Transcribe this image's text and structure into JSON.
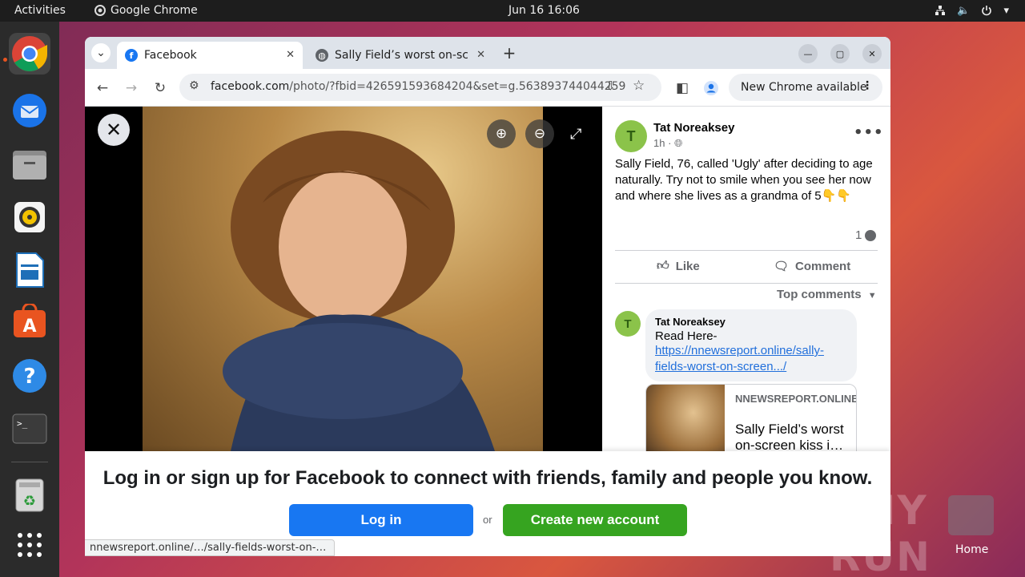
{
  "topbar": {
    "activities": "Activities",
    "app_name": "Google Chrome",
    "clock": "Jun 16  16:06"
  },
  "dock": {
    "items": [
      "Google Chrome",
      "Thunderbird Mail",
      "Files",
      "Rhythmbox",
      "LibreOffice Writer",
      "Ubuntu Software",
      "Help",
      "Terminal",
      "Trash",
      "Show Applications"
    ]
  },
  "browser": {
    "tabs": [
      {
        "title": "Facebook",
        "active": true
      },
      {
        "title": "Sally Field’s worst on-scr",
        "active": false
      }
    ],
    "url_host": "facebook.com",
    "url_path": "/photo/?fbid=426591593684204&set=g.563893744044259",
    "new_chrome": "New Chrome available",
    "status_url": "nnewsreport.online/…/sally-fields-worst-on-…"
  },
  "post": {
    "author": "Tat Noreaksey",
    "author_initial": "T",
    "time": "1h ·",
    "text": "Sally Field, 76, called 'Ugly' after deciding to age naturally. Try not to smile when you see her now and where she lives as a grandma of 5👇👇",
    "comment_count": "1",
    "like_label": "Like",
    "comment_label": "Comment",
    "top_comments": "Top comments"
  },
  "comment": {
    "author": "Tat Noreaksey",
    "author_initial": "T",
    "text": "Read Here-",
    "link": "https://nnewsreport.online/sally-fields-worst-on-screen.../",
    "card_domain": "NNEWSREPORT.ONLINE",
    "card_title": "Sally Field’s worst on-screen kiss i…"
  },
  "login_prompt": {
    "message": "Log in or sign up for Facebook to connect with friends, family and people you know.",
    "login": "Log in",
    "or": "or",
    "create": "Create new account"
  },
  "desktop": {
    "watermark": "ANY RUN",
    "home_label": "Home"
  },
  "colors": {
    "facebook_blue": "#1877f2",
    "create_green": "#36a420",
    "ubuntu_orange": "#e95420"
  }
}
